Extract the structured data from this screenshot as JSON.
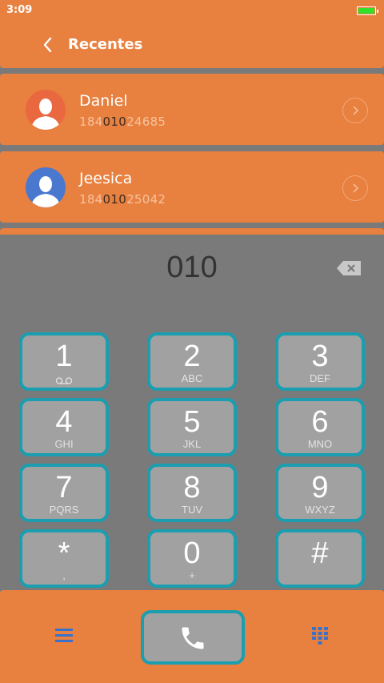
{
  "status": {
    "time": "3:09"
  },
  "header": {
    "title": "Recentes"
  },
  "contacts": [
    {
      "name": "Daniel",
      "num_pre": "184",
      "num_match": "010",
      "num_post": "24685",
      "avatar_color": "#e9683f"
    },
    {
      "name": "Jeesica",
      "num_pre": "184",
      "num_match": "010",
      "num_post": "25042",
      "avatar_color": "#4a78cf"
    }
  ],
  "dialer": {
    "entered": "010"
  },
  "keys": [
    {
      "digit": "1",
      "letters": "voicemail-icon"
    },
    {
      "digit": "2",
      "letters": "ABC"
    },
    {
      "digit": "3",
      "letters": "DEF"
    },
    {
      "digit": "4",
      "letters": "GHI"
    },
    {
      "digit": "5",
      "letters": "JKL"
    },
    {
      "digit": "6",
      "letters": "MNO"
    },
    {
      "digit": "7",
      "letters": "PQRS"
    },
    {
      "digit": "8",
      "letters": "TUV"
    },
    {
      "digit": "9",
      "letters": "WXYZ"
    },
    {
      "digit": "*",
      "letters": ","
    },
    {
      "digit": "0",
      "letters": "+"
    },
    {
      "digit": "#",
      "letters": ""
    }
  ],
  "colors": {
    "accent": "#e8803f",
    "key_border": "#1a9eb0",
    "key_fill": "#a1a1a1",
    "icon_blue": "#3b72c9"
  }
}
